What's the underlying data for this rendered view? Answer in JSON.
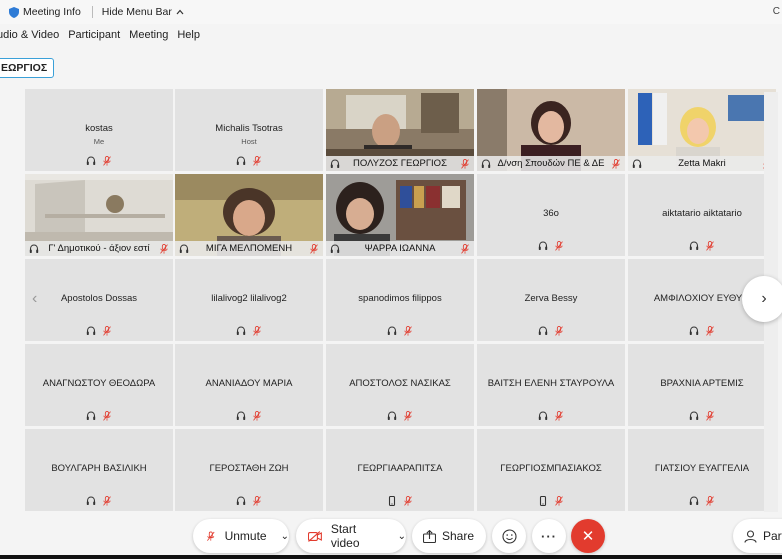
{
  "topbar": {
    "meeting_info": "Meeting Info",
    "hide_menu": "Hide Menu Bar",
    "right_cut": "C"
  },
  "menu": [
    "udio & Video",
    "Participant",
    "Meeting",
    "Help"
  ],
  "name_chip": "ΕΩΡΓΙΟΣ",
  "tiles": [
    {
      "name": "kostas",
      "role": "Me"
    },
    {
      "name": "Michalis Tsotras",
      "role": "Host"
    },
    {
      "name": "ΠΟΛΥΖΟΣ ΓΕΩΡΓΙΟΣ"
    },
    {
      "name": "Δ/νση Σπουδών ΠΕ & ΔΕ"
    },
    {
      "name": "Zetta Makri"
    },
    {
      "name": "Γ' Δημοτικού - άξιον εστί"
    },
    {
      "name": "ΜΙΓΑ ΜΕΛΠΟΜΕΝΗ"
    },
    {
      "name": "ΨΑΡΡΑ ΙΩΑΝΝΑ"
    },
    {
      "name": "36o"
    },
    {
      "name": "aiktatario aiktatario"
    },
    {
      "name": "Apostolos Dossas"
    },
    {
      "name": "lilalivog2 lilalivog2"
    },
    {
      "name": "spanodimos filippos"
    },
    {
      "name": "Zerva Bessy"
    },
    {
      "name": "ΑΜΦΙΛΟΧΙΟΥ ΕΥΘΥΜ"
    },
    {
      "name": "ΑΝΑΓΝΩΣΤΟΥ ΘΕΟΔΩΡΑ"
    },
    {
      "name": "ΑΝΑΝΙΑΔΟΥ ΜΑΡΙΑ"
    },
    {
      "name": "ΑΠΟΣΤΟΛΟΣ ΝΑΣΙΚΑΣ"
    },
    {
      "name": "ΒΑΙΤΣΗ ΕΛΕΝΗ ΣΤΑΥΡΟΥΛΑ"
    },
    {
      "name": "ΒΡΑΧΝΙΑ ΑΡΤΕΜΙΣ"
    },
    {
      "name": "ΒΟΥΛΓΑΡΗ ΒΑΣΙΛΙΚΗ"
    },
    {
      "name": "ΓΕΡΟΣΤΑΘΗ ΖΩΗ"
    },
    {
      "name": "ΓΕΩΡΓΙΑΑΡΑΠΙΤΣΑ"
    },
    {
      "name": "ΓΕΩΡΓΙΟΣΜΠΑΣΙΑΚΟΣ"
    },
    {
      "name": "ΓΙΑΤΣΙΟΥ ΕΥΑΓΓΕΛΙΑ"
    }
  ],
  "controls": {
    "unmute": "Unmute",
    "start_video": "Start video",
    "share": "Share",
    "participants": "Parti"
  },
  "colors": {
    "accent": "#5ac8f0",
    "mute_red": "#e23b2e",
    "tile_bg": "#e2e2e2"
  }
}
